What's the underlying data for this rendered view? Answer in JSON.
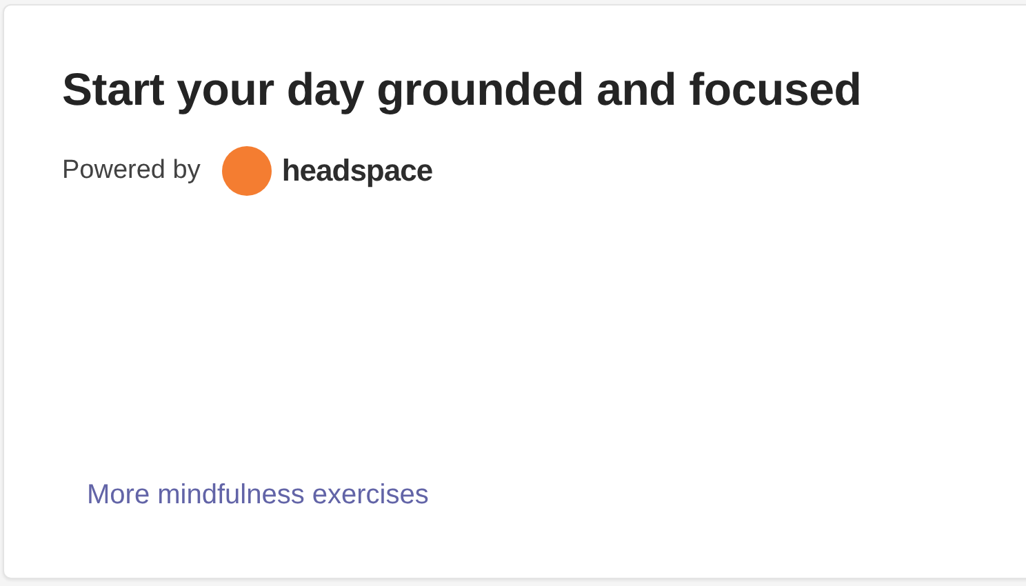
{
  "card": {
    "title": "Start your day grounded and focused",
    "powered_by": "Powered by",
    "brand": "headspace",
    "link": "More mindfulness exercises"
  }
}
